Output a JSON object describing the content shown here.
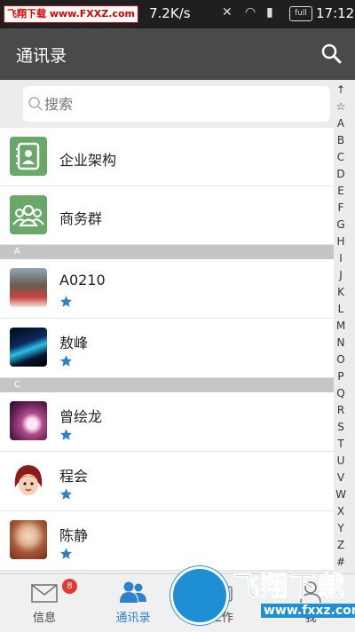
{
  "status_bar": {
    "watermark": "飞翔下载 www.FXXZ.com",
    "speed": "7.2K/s",
    "battery": "full",
    "time": "17:12"
  },
  "app_bar": {
    "title": "通讯录",
    "icon": "search-icon"
  },
  "search": {
    "placeholder": "搜索"
  },
  "fixed_items": [
    {
      "label": "企业架构",
      "icon": "org-chart-icon",
      "color": "#6aa86a"
    },
    {
      "label": "商务群",
      "icon": "group-icon",
      "color": "#6aa86a"
    }
  ],
  "sections": [
    {
      "letter": "A",
      "contacts": [
        {
          "name": "A0210",
          "starred": true
        },
        {
          "name": "敖峰",
          "starred": true
        }
      ]
    },
    {
      "letter": "C",
      "contacts": [
        {
          "name": "曾绘龙",
          "starred": true
        },
        {
          "name": "程会",
          "starred": true
        },
        {
          "name": "陈静",
          "starred": true
        }
      ]
    }
  ],
  "index": [
    "↑",
    "☆",
    "A",
    "B",
    "C",
    "D",
    "E",
    "F",
    "G",
    "H",
    "I",
    "J",
    "K",
    "L",
    "M",
    "N",
    "O",
    "P",
    "Q",
    "R",
    "S",
    "T",
    "U",
    "V",
    "W",
    "X",
    "Y",
    "Z",
    "#"
  ],
  "bottom_nav": {
    "tabs": [
      {
        "label": "信息",
        "icon": "envelope-icon",
        "badge": "8",
        "active": false
      },
      {
        "label": "通讯录",
        "icon": "contacts-icon",
        "active": true
      },
      {
        "label": "工作",
        "icon": "work-icon",
        "active": false
      },
      {
        "label": "我",
        "icon": "me-icon",
        "active": false
      }
    ]
  },
  "watermark_logo": {
    "text_cn": "飞翔下载",
    "url": "www.fxxz.com"
  },
  "colors": {
    "accent": "#2b82c9",
    "star": "#2b82c9",
    "badge": "#e5392f",
    "app_bar": "#4a4a4a",
    "section_header": "#c5c5c5"
  }
}
